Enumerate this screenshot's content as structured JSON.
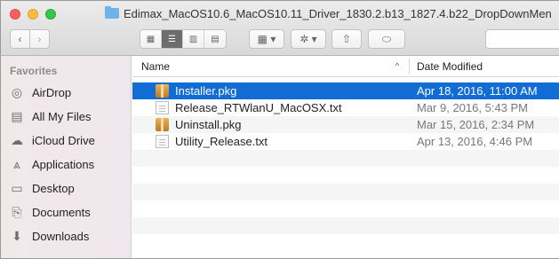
{
  "window": {
    "title": "Edimax_MacOS10.6_MacOS10.11_Driver_1830.2.b13_1827.4.b22_DropDownMen"
  },
  "toolbar": {
    "back_icon": "chevron-left-icon",
    "forward_icon": "chevron-right-icon",
    "back_glyph": "‹",
    "forward_glyph": "›",
    "view_glyphs": [
      "▦",
      "☰",
      "▥",
      "▤"
    ],
    "arrange_glyph": "▦ ▾",
    "action_glyph": "✲ ▾",
    "share_glyph": "⇧",
    "tag_glyph": "⬭"
  },
  "sidebar": {
    "heading": "Favorites",
    "items": [
      {
        "label": "AirDrop",
        "icon": "airdrop-icon",
        "glyph": "◎"
      },
      {
        "label": "All My Files",
        "icon": "all-files-icon",
        "glyph": "▤"
      },
      {
        "label": "iCloud Drive",
        "icon": "cloud-icon",
        "glyph": "☁"
      },
      {
        "label": "Applications",
        "icon": "applications-icon",
        "glyph": "⩓"
      },
      {
        "label": "Desktop",
        "icon": "desktop-icon",
        "glyph": "▭"
      },
      {
        "label": "Documents",
        "icon": "documents-icon",
        "glyph": "⎘"
      },
      {
        "label": "Downloads",
        "icon": "downloads-icon",
        "glyph": "⬇"
      }
    ]
  },
  "list": {
    "columns": {
      "name": "Name",
      "date": "Date Modified"
    },
    "sort_glyph": "^",
    "files": [
      {
        "name": "Installer.pkg",
        "date": "Apr 18, 2016, 11:00 AM",
        "type": "pkg",
        "selected": true
      },
      {
        "name": "Release_RTWlanU_MacOSX.txt",
        "date": "Mar 9, 2016, 5:43 PM",
        "type": "txt",
        "selected": false
      },
      {
        "name": "Uninstall.pkg",
        "date": "Mar 15, 2016, 2:34 PM",
        "type": "pkg",
        "selected": false
      },
      {
        "name": "Utility_Release.txt",
        "date": "Apr 13, 2016, 4:46 PM",
        "type": "txt",
        "selected": false
      }
    ]
  },
  "colors": {
    "selection": "#116cd6",
    "folder": "#6fb3ea"
  }
}
